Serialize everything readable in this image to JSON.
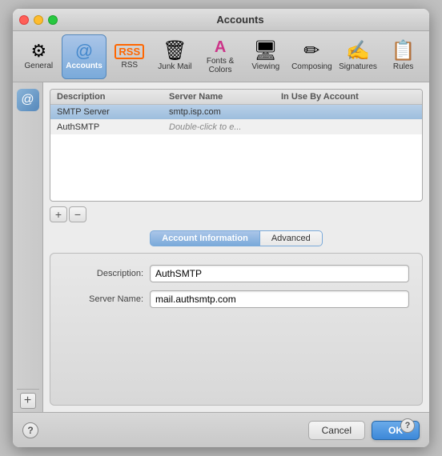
{
  "window": {
    "title": "Accounts",
    "traffic_lights": {
      "close": "close",
      "minimize": "minimize",
      "maximize": "maximize"
    }
  },
  "toolbar": {
    "items": [
      {
        "id": "general",
        "label": "General",
        "icon": "⚙"
      },
      {
        "id": "accounts",
        "label": "Accounts",
        "icon": "@",
        "active": true
      },
      {
        "id": "rss",
        "label": "RSS",
        "icon": "RSS"
      },
      {
        "id": "junk-mail",
        "label": "Junk Mail",
        "icon": "✉"
      },
      {
        "id": "fonts-colors",
        "label": "Fonts & Colors",
        "icon": "A"
      },
      {
        "id": "viewing",
        "label": "Viewing",
        "icon": "👁"
      },
      {
        "id": "composing",
        "label": "Composing",
        "icon": "✏"
      },
      {
        "id": "signatures",
        "label": "Signatures",
        "icon": "✍"
      },
      {
        "id": "rules",
        "label": "Rules",
        "icon": "📋"
      }
    ]
  },
  "smtp_table": {
    "headers": [
      "Description",
      "Server Name",
      "In Use By Account"
    ],
    "rows": [
      {
        "description": "SMTP Server",
        "server": "smtp.isp.com",
        "inuse": "",
        "selected": true
      },
      {
        "description": "AuthSMTP",
        "server": "Double-click to e...",
        "inuse": "",
        "selected": false,
        "inactive": true
      }
    ]
  },
  "add_remove": {
    "add_label": "+",
    "remove_label": "−"
  },
  "tabs": [
    {
      "id": "account-info",
      "label": "Account Information",
      "active": true
    },
    {
      "id": "advanced",
      "label": "Advanced",
      "active": false
    }
  ],
  "form": {
    "description_label": "Description:",
    "description_value": "AuthSMTP",
    "server_name_label": "Server Name:",
    "server_name_value": "mail.authsmtp.com"
  },
  "bottom": {
    "help_label": "?",
    "cancel_label": "Cancel",
    "ok_label": "OK",
    "right_help_label": "?"
  }
}
